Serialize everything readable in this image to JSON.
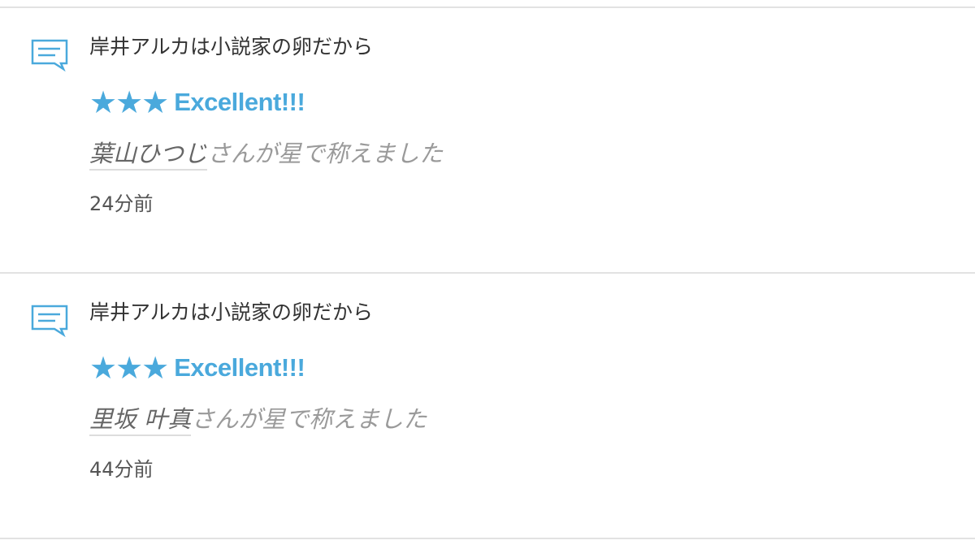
{
  "accent_color": "#4aa9dc",
  "notifications": [
    {
      "icon": "comment-icon",
      "work_title": "岸井アルカは小説家の卵だから",
      "stars": "★★★",
      "rating_label": "Excellent!!!",
      "user_name": "葉山ひつじ",
      "praise_text": "さんが星で称えました",
      "time": "24分前"
    },
    {
      "icon": "comment-icon",
      "work_title": "岸井アルカは小説家の卵だから",
      "stars": "★★★",
      "rating_label": "Excellent!!!",
      "user_name": "里坂 叶真",
      "praise_text": "さんが星で称えました",
      "time": "44分前"
    }
  ]
}
